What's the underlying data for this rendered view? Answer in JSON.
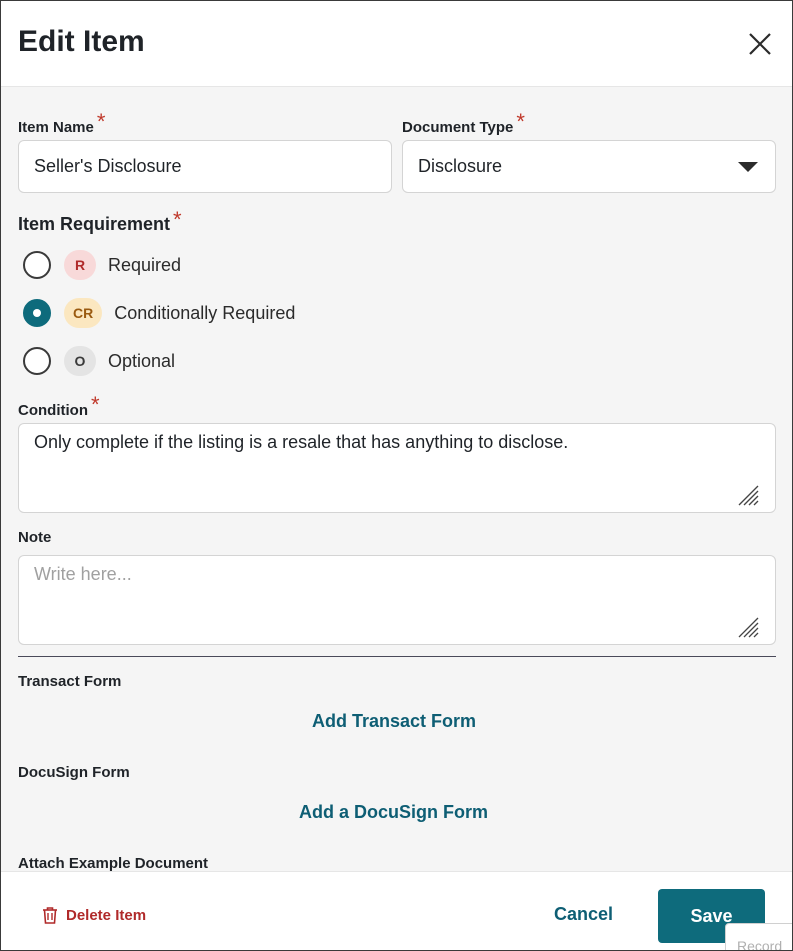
{
  "header": {
    "title": "Edit Item"
  },
  "item_name": {
    "label": "Item Name",
    "required_mark": "*",
    "value": "Seller's Disclosure"
  },
  "document_type": {
    "label": "Document Type",
    "required_mark": "*",
    "selected": "Disclosure"
  },
  "requirement": {
    "label": "Item Requirement",
    "required_mark": "*",
    "options": [
      {
        "badge": "R",
        "label": "Required",
        "checked": false
      },
      {
        "badge": "CR",
        "label": "Conditionally Required",
        "checked": true
      },
      {
        "badge": "O",
        "label": "Optional",
        "checked": false
      }
    ]
  },
  "condition": {
    "label": "Condition",
    "required_mark": "*",
    "value": "Only complete if the listing is a resale that has anything to disclose."
  },
  "note": {
    "label": "Note",
    "placeholder": "Write here..."
  },
  "transact_form": {
    "label": "Transact Form",
    "link": "Add Transact Form"
  },
  "docusign_form": {
    "label": "DocuSign Form",
    "link": "Add a DocuSign Form"
  },
  "attach": {
    "label": "Attach Example Document"
  },
  "footer": {
    "delete_label": "Delete Item",
    "cancel_label": "Cancel",
    "save_label": "Save",
    "record_label": "Record"
  },
  "colors": {
    "accent": "#0e6b7c",
    "link": "#0e5e74",
    "danger": "#b02a2a",
    "required": "#c0392b"
  }
}
